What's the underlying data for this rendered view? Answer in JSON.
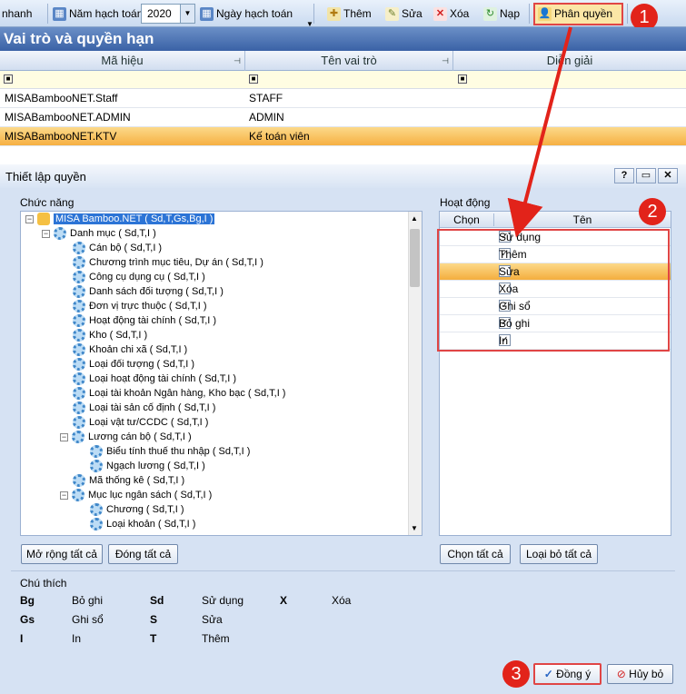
{
  "toolbar": {
    "left_label": "nhanh",
    "year_label": "Năm hạch toán",
    "year_value": "2020",
    "date_label": "Ngày hạch toán",
    "add_label": "Thêm",
    "edit_label": "Sửa",
    "delete_label": "Xóa",
    "reload_label": "Nạp",
    "permission_label": "Phân quyền"
  },
  "badges": {
    "one": "1",
    "two": "2",
    "three": "3"
  },
  "list": {
    "title": "Vai trò và quyền hạn",
    "columns": {
      "code": "Mã hiệu",
      "name": "Tên vai trò",
      "desc": "Diễn giải"
    },
    "rows": [
      {
        "code": "MISABambooNET.Staff",
        "name": "STAFF"
      },
      {
        "code": "MISABambooNET.ADMIN",
        "name": "ADMIN"
      },
      {
        "code": "MISABambooNET.KTV",
        "name": "Kế toán viên"
      }
    ]
  },
  "dialog": {
    "title": "Thiết lập quyền",
    "help_btn": "?",
    "functions_label": "Chức năng",
    "activities_label": "Hoạt động",
    "tree": [
      {
        "label": "MISA Bamboo.NET ( Sd,T,Gs,Bg,I )"
      },
      {
        "label": "Danh mục ( Sd,T,I )"
      },
      {
        "label": "Cán bộ ( Sd,T,I )"
      },
      {
        "label": "Chương trình mục tiêu, Dự án ( Sd,T,I )"
      },
      {
        "label": "Công cụ dụng cụ ( Sd,T,I )"
      },
      {
        "label": "Danh sách đối tượng ( Sd,T,I )"
      },
      {
        "label": "Đơn vị trực thuộc ( Sd,T,I )"
      },
      {
        "label": "Hoạt động tài chính ( Sd,T,I )"
      },
      {
        "label": "Kho ( Sd,T,I )"
      },
      {
        "label": "Khoản chi xã ( Sd,T,I )"
      },
      {
        "label": "Loại đối tượng ( Sd,T,I )"
      },
      {
        "label": "Loại hoạt động tài chính ( Sd,T,I )"
      },
      {
        "label": "Loại tài khoản Ngân hàng, Kho bạc ( Sd,T,I )"
      },
      {
        "label": "Loại tài sản cố định ( Sd,T,I )"
      },
      {
        "label": "Loại vật tư/CCDC ( Sd,T,I )"
      },
      {
        "label": "Lương cán bộ ( Sd,T,I )"
      },
      {
        "label": "Biểu tính thuế thu nhập ( Sd,T,I )"
      },
      {
        "label": "Ngạch lương ( Sd,T,I )"
      },
      {
        "label": "Mã thống kê ( Sd,T,I )"
      },
      {
        "label": "Mục lục ngân sách ( Sd,T,I )"
      },
      {
        "label": "Chương ( Sd,T,I )"
      },
      {
        "label": "Loại khoản ( Sd,T,I )"
      }
    ],
    "expand_all": "Mở rộng tất cả",
    "collapse_all": "Đóng tất cả",
    "acts_head": {
      "choose": "Chọn",
      "name": "Tên"
    },
    "activities": [
      {
        "name": "Sử dụng",
        "checked": "✓"
      },
      {
        "name": "Thêm",
        "checked": "✓"
      },
      {
        "name": "Sửa",
        "checked": ""
      },
      {
        "name": "Xóa",
        "checked": ""
      },
      {
        "name": "Ghi sổ",
        "checked": "✓"
      },
      {
        "name": "Bỏ ghi",
        "checked": "✓"
      },
      {
        "name": "In",
        "checked": "✓"
      }
    ],
    "select_all": "Chọn tất cả",
    "deselect_all": "Loại bỏ tất cả",
    "legend_title": "Chú thích",
    "legend": [
      {
        "k": "Bg",
        "v": "Bỏ ghi"
      },
      {
        "k": "Sd",
        "v": "Sử dụng"
      },
      {
        "k": "X",
        "v": "Xóa"
      },
      {
        "k": "Gs",
        "v": "Ghi sổ"
      },
      {
        "k": "S",
        "v": "Sửa"
      },
      {
        "k": "I",
        "v": "In"
      },
      {
        "k": "T",
        "v": "Thêm"
      }
    ],
    "ok": "Đồng ý",
    "cancel": "Hủy bỏ"
  }
}
